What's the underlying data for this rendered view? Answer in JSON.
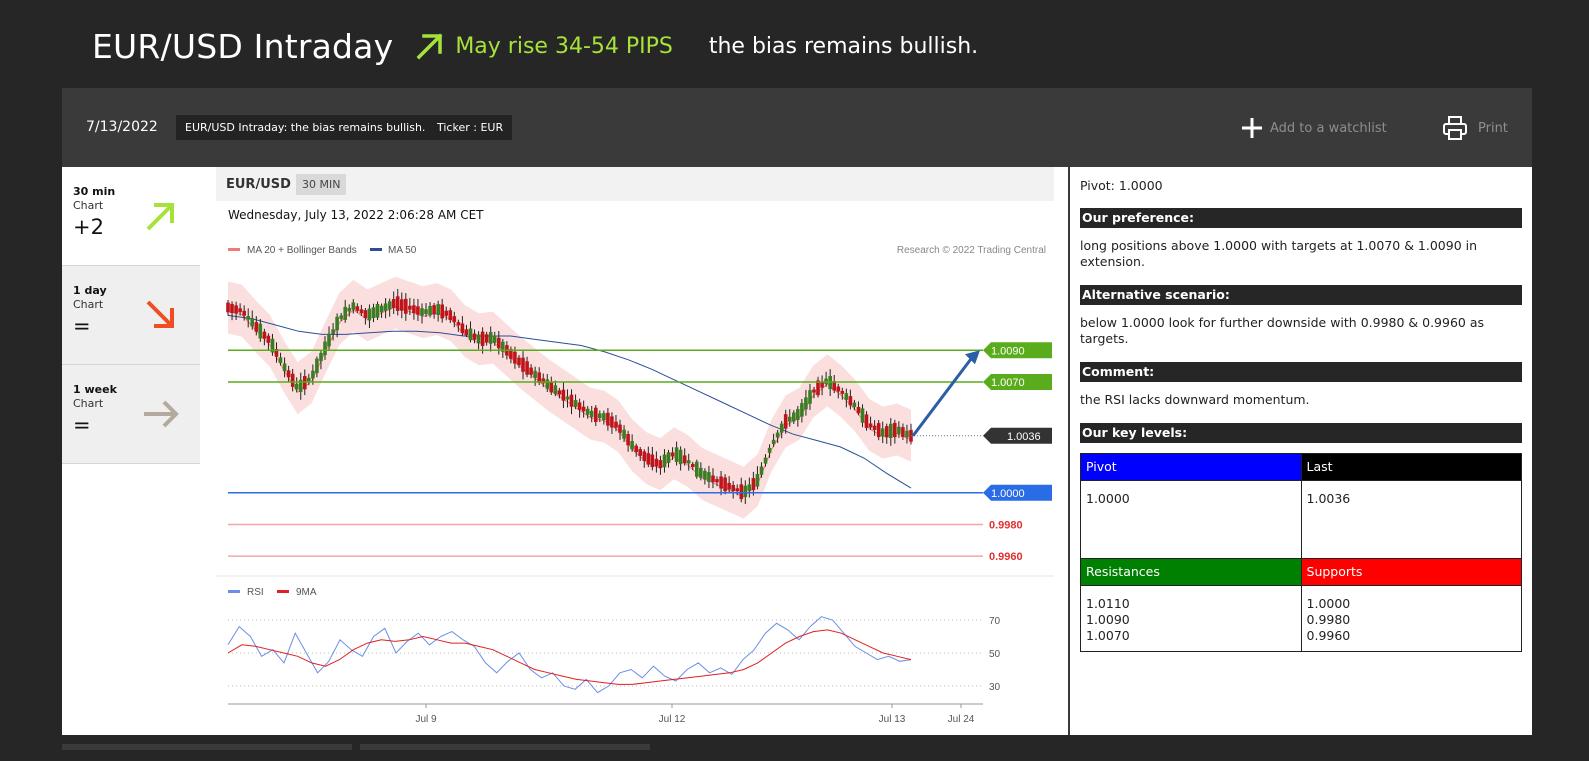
{
  "header": {
    "title": "EUR/USD Intraday",
    "rise_text": "May rise 34-54 PIPS",
    "bias_text": "the bias remains bullish.",
    "accent_color": "#a7e23a"
  },
  "toolbar": {
    "date": "7/13/2022",
    "headline_chip": "EUR/USD Intraday: the bias remains bullish.",
    "ticker_chip": "Ticker : EUR",
    "watchlist_label": "Add to a watchlist",
    "watchlist_icon": "plus-icon",
    "print_label": "Print",
    "print_icon": "printer-icon"
  },
  "timeframes": [
    {
      "name": "30 min",
      "sub": "Chart",
      "value": "+2",
      "arrow": "arrow-up-right-icon",
      "color": "#a7e23a"
    },
    {
      "name": "1 day",
      "sub": "Chart",
      "value": "=",
      "arrow": "arrow-down-right-icon",
      "color": "#f04d23"
    },
    {
      "name": "1 week",
      "sub": "Chart",
      "value": "=",
      "arrow": "arrow-right-icon",
      "color": "#b3a99c"
    }
  ],
  "chart": {
    "symbol": "EUR/USD",
    "timeframe": "30 MIN",
    "timestamp": "Wednesday, July 13, 2022 2:06:28 AM CET",
    "legend_ma20": "MA 20 + Bollinger Bands",
    "legend_ma50": "MA 50",
    "copyright": "Research © 2022 Trading Central",
    "rsi_legend": "RSI",
    "rsi_ma_legend": "9MA"
  },
  "chart_data": {
    "type": "line",
    "ylim": [
      0.995,
      1.0135
    ],
    "price_path": [
      1.0117,
      1.0115,
      1.0105,
      1.0096,
      1.008,
      1.0066,
      1.0073,
      1.0092,
      1.011,
      1.0118,
      1.0112,
      1.0116,
      1.012,
      1.0117,
      1.0114,
      1.0116,
      1.0112,
      1.0102,
      1.0097,
      1.0098,
      1.009,
      1.0082,
      1.0075,
      1.0068,
      1.0062,
      1.0056,
      1.005,
      1.0048,
      1.0042,
      1.003,
      1.0022,
      1.0018,
      1.0025,
      1.002,
      1.0012,
      1.0008,
      1.0004,
      1.0,
      1.0008,
      1.003,
      1.0045,
      1.005,
      1.0064,
      1.0071,
      1.0064,
      1.0055,
      1.0043,
      1.0038,
      1.004,
      1.0036
    ],
    "ma50_path": [
      1.0112,
      1.011,
      1.0106,
      1.0102,
      1.01,
      1.01,
      1.0101,
      1.0102,
      1.0102,
      1.0101,
      1.0099,
      1.0099,
      1.0099,
      1.0097,
      1.0095,
      1.0093,
      1.0089,
      1.0084,
      1.0078,
      1.0071,
      1.0064,
      1.0057,
      1.005,
      1.0043,
      1.0037,
      1.0033,
      1.0029,
      1.0022,
      1.0012,
      1.0003
    ],
    "levels": [
      {
        "label": "1.0090",
        "value": 1.009,
        "kind": "resistance",
        "color": "#5aac1d"
      },
      {
        "label": "1.0070",
        "value": 1.007,
        "kind": "resistance",
        "color": "#5aac1d"
      },
      {
        "label": "1.0036",
        "value": 1.0036,
        "kind": "last",
        "color": "#333333"
      },
      {
        "label": "1.0000",
        "value": 1.0,
        "kind": "pivot",
        "color": "#2a6ce6"
      },
      {
        "label": "0.9980",
        "value": 0.998,
        "kind": "support",
        "color": "#e03030"
      },
      {
        "label": "0.9960",
        "value": 0.996,
        "kind": "support",
        "color": "#e03030"
      }
    ],
    "x_ticks": [
      "Jul 9",
      "Jul 12",
      "Jul 13",
      "Jul 24"
    ],
    "rsi_ticks": [
      "70",
      "50",
      "30"
    ],
    "rsi": [
      55,
      66,
      60,
      48,
      52,
      44,
      62,
      50,
      38,
      45,
      58,
      52,
      48,
      60,
      65,
      50,
      57,
      62,
      55,
      60,
      63,
      58,
      54,
      44,
      38,
      45,
      50,
      40,
      35,
      38,
      30,
      28,
      34,
      26,
      30,
      38,
      40,
      35,
      42,
      36,
      33,
      40,
      44,
      38,
      41,
      37,
      46,
      52,
      62,
      68,
      64,
      58,
      66,
      72,
      70,
      62,
      54,
      50,
      46,
      48,
      45,
      46
    ],
    "rsi_ma": [
      50,
      55,
      54,
      52,
      50,
      48,
      44,
      42,
      46,
      52,
      56,
      58,
      57,
      58,
      60,
      58,
      56,
      56,
      54,
      52,
      48,
      44,
      40,
      38,
      36,
      34,
      33,
      32,
      31,
      31,
      32,
      33,
      34,
      35,
      36,
      37,
      38,
      40,
      44,
      50,
      56,
      60,
      63,
      64,
      62,
      58,
      54,
      50,
      48,
      46
    ]
  },
  "analysis": {
    "pivot_line": "Pivot: 1.0000",
    "preference_title": "Our preference:",
    "preference_text": "long positions above 1.0000 with targets at 1.0070 & 1.0090 in extension.",
    "alternative_title": "Alternative scenario:",
    "alternative_text": "below 1.0000 look for further downside with 0.9980 & 0.9960 as targets.",
    "comment_title": "Comment:",
    "comment_text": "the RSI lacks downward momentum.",
    "key_levels_title": "Our key levels:",
    "key_levels": {
      "pivot_label": "Pivot",
      "pivot_value": "1.0000",
      "last_label": "Last",
      "last_value": "1.0036",
      "resistances_label": "Resistances",
      "resistances": [
        "1.0110",
        "1.0090",
        "1.0070"
      ],
      "supports_label": "Supports",
      "supports": [
        "1.0000",
        "0.9980",
        "0.9960"
      ],
      "colors": {
        "pivot": "#0000ff",
        "last": "#000000",
        "resistances": "#008000",
        "supports": "#ff0000"
      }
    }
  }
}
